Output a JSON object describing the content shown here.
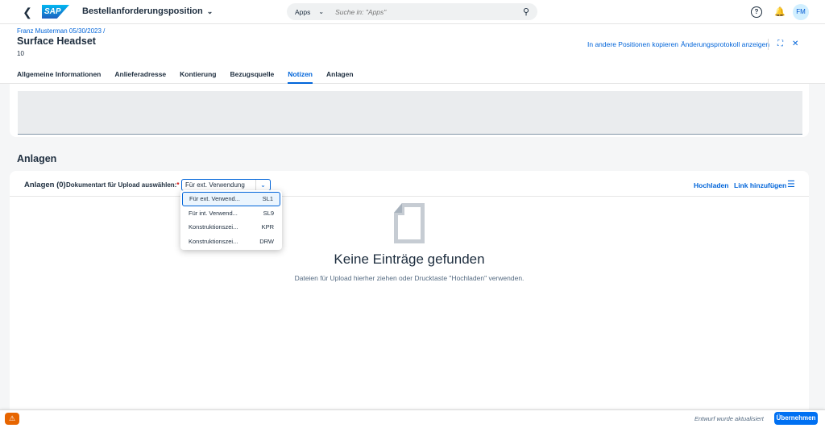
{
  "shell": {
    "logo_text": "SAP",
    "app_title": "Bestellanforderungsposition",
    "search_scope": "Apps",
    "search_placeholder": "Suche in: \"Apps\"",
    "help_glyph": "?",
    "avatar_initials": "FM"
  },
  "header": {
    "breadcrumb": "Franz Musterman 05/30/2023 /",
    "title": "Surface Headset",
    "subtitle": "10",
    "actions": {
      "copy": "In andere Positionen kopieren",
      "changelog": "Änderungsprotokoll anzeigen"
    },
    "tabs": [
      {
        "label": "Allgemeine Informationen"
      },
      {
        "label": "Anlieferadresse"
      },
      {
        "label": "Kontierung"
      },
      {
        "label": "Bezugsquelle"
      },
      {
        "label": "Notizen"
      },
      {
        "label": "Anlagen"
      }
    ],
    "active_tab": "Notizen"
  },
  "attachments": {
    "section_title": "Anlagen",
    "count_label": "Anlagen (0)",
    "doc_type_label": "Dokumentart für Upload auswählen:",
    "required_marker": "*",
    "selected_doc_type": "Für ext. Verwendung",
    "upload_label": "Hochladen",
    "add_link_label": "Link hinzufügen",
    "empty_title": "Keine Einträge gefunden",
    "empty_description": "Dateien für Upload hierher ziehen oder Drucktaste \"Hochladen\" verwenden.",
    "options": [
      {
        "text": "Für ext. Verwend...",
        "code": "SL1"
      },
      {
        "text": "Für int. Verwend...",
        "code": "SL9"
      },
      {
        "text": "Konstruktionszei...",
        "code": "KPR"
      },
      {
        "text": "Konstruktionszei...",
        "code": "DRW"
      }
    ]
  },
  "footer": {
    "draft_status": "Entwurf wurde aktualisiert",
    "apply_label": "Übernehmen"
  },
  "colors": {
    "accent": "#0064d9",
    "emphasized_button": "#0070f2",
    "warning": "#e76500"
  }
}
